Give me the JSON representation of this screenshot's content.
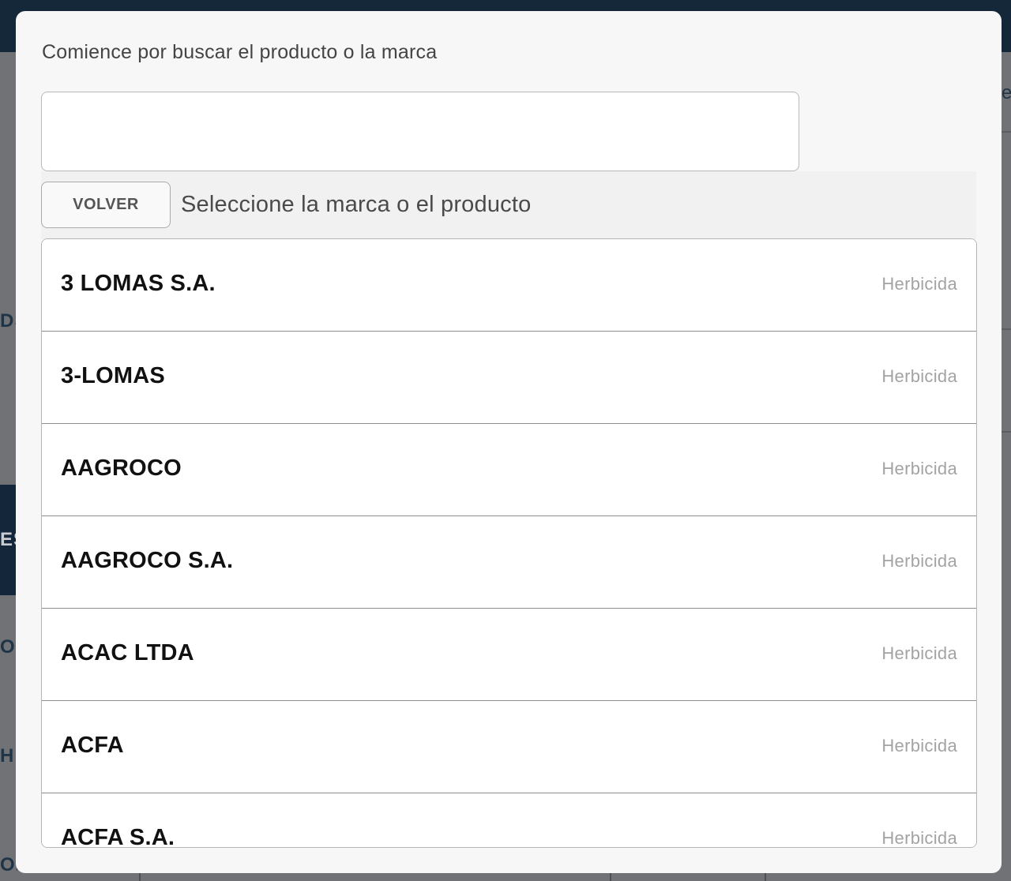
{
  "background": {
    "fragments": [
      {
        "text": "DS"
      },
      {
        "text": "ES"
      },
      {
        "text": "ON"
      },
      {
        "text": "HI"
      },
      {
        "text": "ON"
      }
    ],
    "right_fragment": "e"
  },
  "modal": {
    "heading": "Comience por buscar el producto o la marca",
    "search": {
      "value": "",
      "placeholder": ""
    },
    "back_button_label": "VOLVER",
    "select_title": "Seleccione la marca o el producto",
    "items": [
      {
        "name": "3 LOMAS S.A.",
        "type": "Herbicida"
      },
      {
        "name": "3-LOMAS",
        "type": "Herbicida"
      },
      {
        "name": "AAGROCO",
        "type": "Herbicida"
      },
      {
        "name": "AAGROCO S.A.",
        "type": "Herbicida"
      },
      {
        "name": "ACAC LTDA",
        "type": "Herbicida"
      },
      {
        "name": "ACFA",
        "type": "Herbicida"
      },
      {
        "name": "ACFA S.A.",
        "type": "Herbicida"
      }
    ]
  },
  "colors": {
    "overlay": "#707275",
    "navbar": "#15283a",
    "modal_bg": "#f7f7f7",
    "item_name": "#111111",
    "item_type": "#a3a3a3"
  }
}
